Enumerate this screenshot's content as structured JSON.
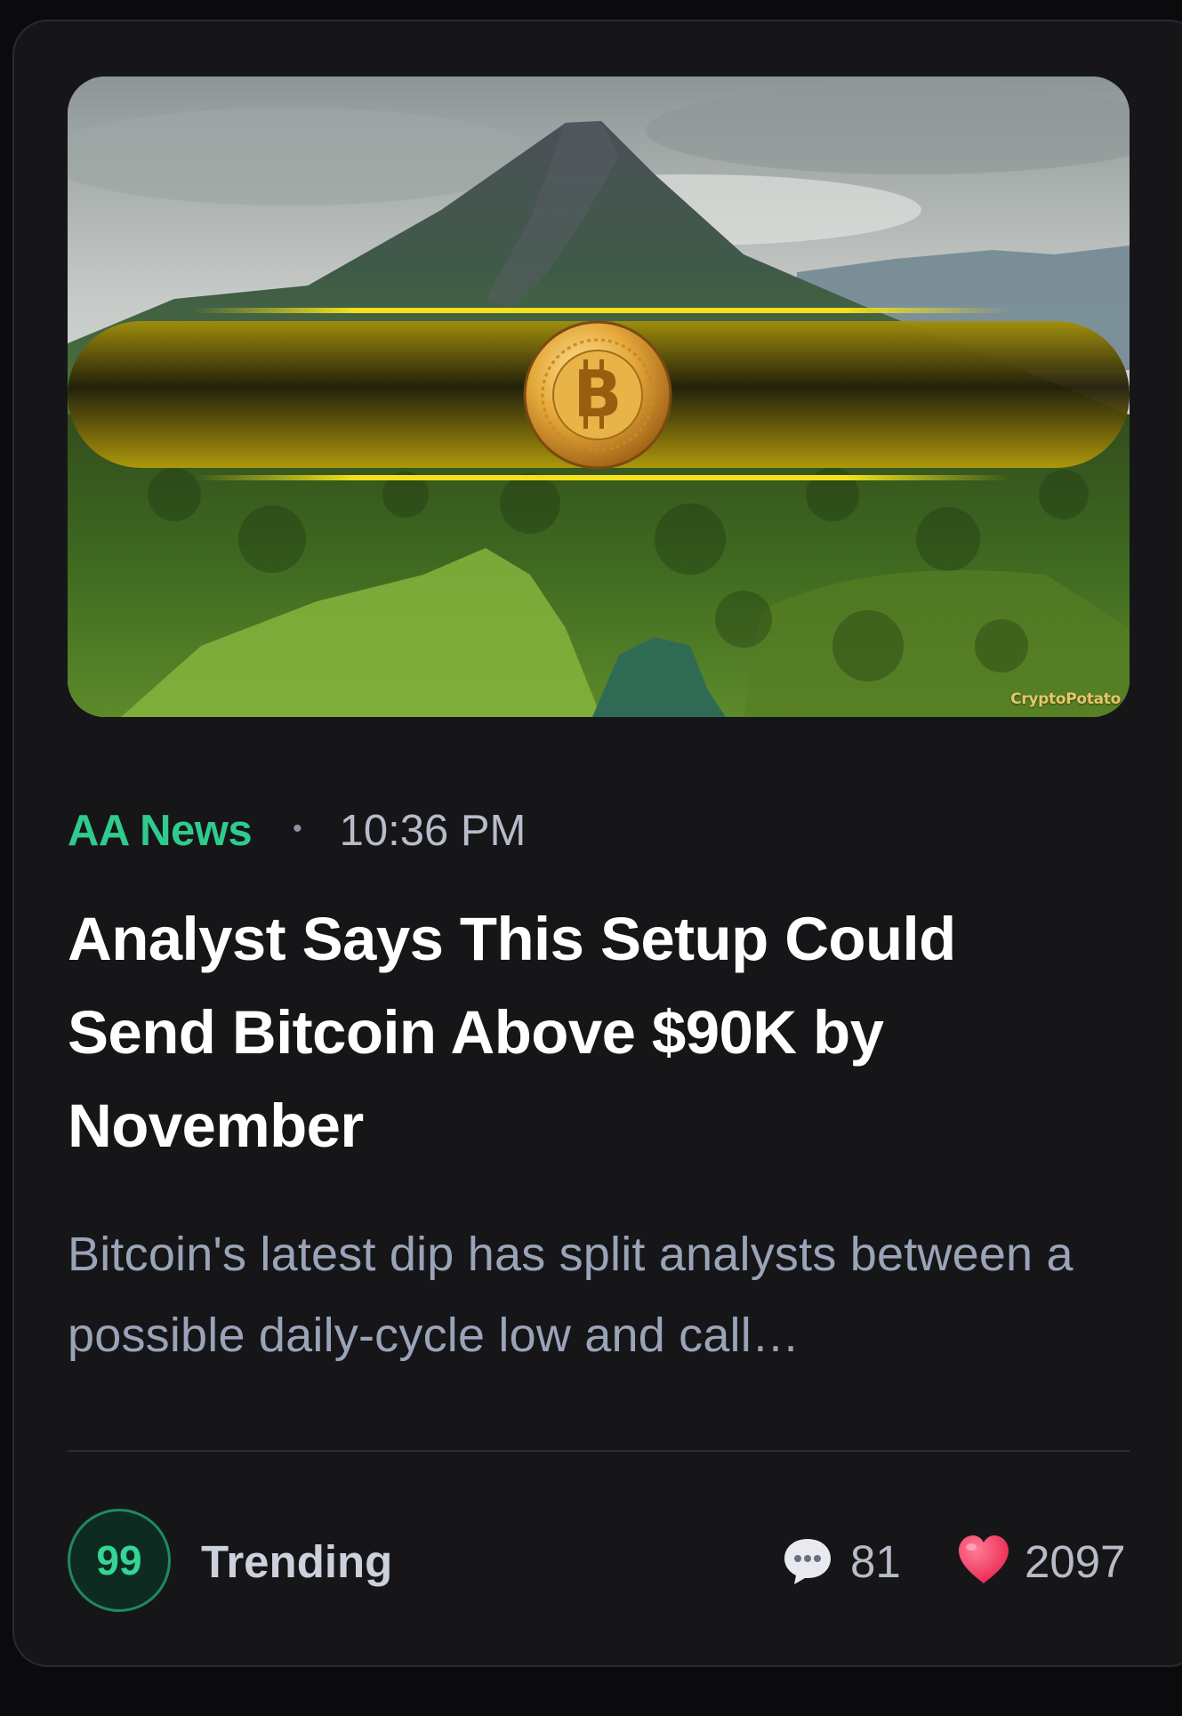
{
  "article": {
    "hero_image": {
      "description_icon": "bitcoin-coin-icon",
      "watermark": "CryptoPotato"
    },
    "source": "AA News",
    "separator": "•",
    "time": "10:36 PM",
    "headline": "Analyst Says This Setup Could Send Bitcoin Above $90K by November",
    "summary": "Bitcoin's latest dip has split analysts between a possible daily-cycle low and call…"
  },
  "footer": {
    "score": "99",
    "trend_label": "Trending",
    "comments": {
      "icon": "speech-bubble-icon",
      "count": "81"
    },
    "likes": {
      "icon": "heart-icon",
      "count": "2097"
    }
  },
  "colors": {
    "background": "#0b0b0d",
    "card": "#161619",
    "accent_green": "#2fcb8e",
    "heart": "#f23b63"
  }
}
